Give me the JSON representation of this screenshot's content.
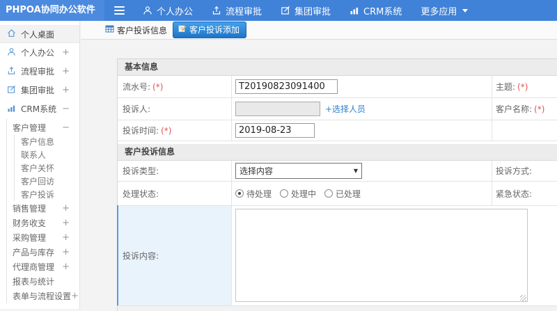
{
  "navbar": {
    "logo": "PHPOA协同办公软件",
    "menu_icon": "hamburger-menu-icon",
    "menu": [
      {
        "label": "个人办公",
        "icon": "user-icon"
      },
      {
        "label": "流程审批",
        "icon": "workflow-share-icon"
      },
      {
        "label": "集团审批",
        "icon": "edit-square-icon"
      },
      {
        "label": "CRM系统",
        "icon": "bar-chart-icon"
      },
      {
        "label": "更多应用",
        "icon": "caret-down-icon"
      }
    ]
  },
  "sidebar": {
    "desktop": {
      "label": "个人桌面",
      "icon": "home-icon"
    },
    "top_items": [
      {
        "label": "个人办公",
        "toggle": "+",
        "icon": "user-icon"
      },
      {
        "label": "流程审批",
        "toggle": "+",
        "icon": "workflow-share-icon"
      },
      {
        "label": "集团审批",
        "toggle": "+",
        "icon": "edit-square-icon"
      },
      {
        "label": "CRM系统",
        "toggle": "−",
        "icon": "bar-chart-icon"
      }
    ],
    "crm": {
      "group_label": "客户管理",
      "group_toggle": "−"
    },
    "crm_subitems": [
      {
        "label": "客户信息"
      },
      {
        "label": "联系人"
      },
      {
        "label": "客户关怀"
      },
      {
        "label": "客户回访"
      },
      {
        "label": "客户投诉"
      }
    ],
    "modules": [
      {
        "label": "销售管理",
        "toggle": "+"
      },
      {
        "label": "财务收支",
        "toggle": "+"
      },
      {
        "label": "采购管理",
        "toggle": "+"
      },
      {
        "label": "产品与库存",
        "toggle": "+"
      },
      {
        "label": "代理商管理",
        "toggle": "+"
      },
      {
        "label": "报表与统计",
        "toggle": ""
      },
      {
        "label": "表单与流程设置",
        "toggle": "+"
      }
    ]
  },
  "tabs": {
    "list": {
      "label": "客户投诉信息",
      "icon": "table-icon"
    },
    "add": {
      "label": "客户投诉添加",
      "icon": "edit-add-icon",
      "active": true
    }
  },
  "form": {
    "required_mark": "(*)",
    "basic": {
      "title": "基本信息",
      "serial": {
        "label": "流水号:",
        "required": true,
        "value": "T20190823091400"
      },
      "subject": {
        "label": "主题:",
        "required": true
      },
      "complainant": {
        "label": "投诉人:",
        "value": "",
        "picker": "+选择人员"
      },
      "customer": {
        "label": "客户名称:",
        "required": true
      },
      "time": {
        "label": "投诉时间:",
        "required": true,
        "value": "2019-08-23"
      }
    },
    "complaint": {
      "title": "客户投诉信息",
      "type": {
        "label": "投诉类型:",
        "value": "选择内容"
      },
      "method": {
        "label": "投诉方式:"
      },
      "status": {
        "label": "处理状态:",
        "options": [
          "待处理",
          "处理中",
          "已处理"
        ],
        "selected": "待处理"
      },
      "urgency": {
        "label": "紧急状态:"
      },
      "content": {
        "label": "投诉内容:",
        "value": ""
      }
    }
  },
  "colors": {
    "navbar_blue": "#4082d8",
    "active_tab_blue": "#1e74c8",
    "link_blue": "#2f80cc",
    "required_red": "#e05353",
    "highlight_cell": "#e9f3fc",
    "focus_edge_blue": "#5b9bd5"
  }
}
